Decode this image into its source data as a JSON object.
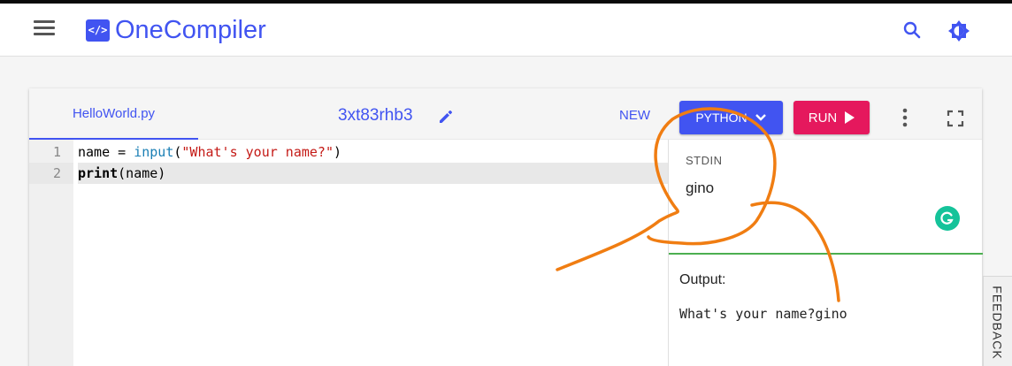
{
  "header": {
    "logo_glyph": "</>",
    "brand": "OneCompiler",
    "brand_color": "#4154f1",
    "icons": [
      "menu-icon",
      "search-icon",
      "brightness-icon"
    ]
  },
  "toolbar": {
    "file_tab": "HelloWorld.py",
    "code_id": "3xt83rhb3",
    "new_label": "NEW",
    "language_label": "PYTHON",
    "run_label": "RUN",
    "run_color": "#e5185d"
  },
  "editor": {
    "line_numbers": [
      "1",
      "2"
    ],
    "lines": [
      {
        "tokens": [
          {
            "text": "name = ",
            "type": "plain"
          },
          {
            "text": "input",
            "type": "fn"
          },
          {
            "text": "(",
            "type": "plain"
          },
          {
            "text": "\"What's your name?\"",
            "type": "str"
          },
          {
            "text": ")",
            "type": "plain"
          }
        ]
      },
      {
        "tokens": [
          {
            "text": "print",
            "type": "kw"
          },
          {
            "text": "(name)",
            "type": "plain"
          }
        ]
      }
    ]
  },
  "stdin": {
    "label": "STDIN",
    "value": "gino"
  },
  "output": {
    "label": "Output:",
    "value": "What's your name?gino"
  },
  "feedback_label": "FEEDBACK",
  "annotation_color": "#f07d12"
}
